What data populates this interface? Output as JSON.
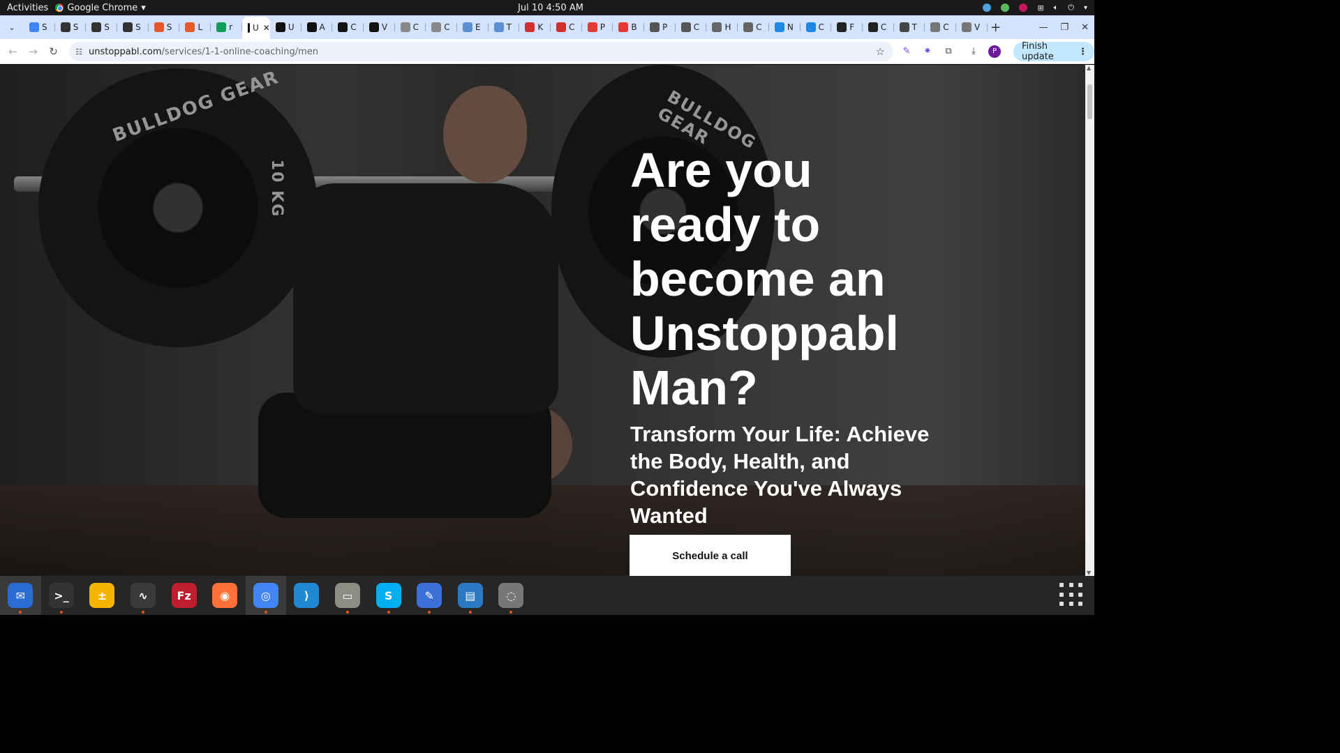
{
  "system_bar": {
    "activities": "Activities",
    "app_name": "Google Chrome",
    "clock": "Jul 10  4:50 AM"
  },
  "tabs": [
    {
      "letter": "S",
      "color": "#4285f4",
      "icon": "docs-icon"
    },
    {
      "letter": "S",
      "color": "#333333",
      "icon": "snp-icon"
    },
    {
      "letter": "S",
      "color": "#333333",
      "icon": "snp-icon"
    },
    {
      "letter": "S",
      "color": "#333333",
      "icon": "snp-icon"
    },
    {
      "letter": "S",
      "color": "#e8552b",
      "icon": "red-face-icon"
    },
    {
      "letter": "L",
      "color": "#e85a2b",
      "icon": "l-logo-icon"
    },
    {
      "letter": "r",
      "color": "#0f9d58",
      "icon": "sheets-plus-icon"
    },
    {
      "letter": "U",
      "color": "#111111",
      "icon": "unstoppabl-icon",
      "active": true
    },
    {
      "letter": "U",
      "color": "#111111",
      "icon": "unstoppabl-icon"
    },
    {
      "letter": "A",
      "color": "#111111",
      "icon": "unstoppabl-icon"
    },
    {
      "letter": "C",
      "color": "#111111",
      "icon": "unstoppabl-icon"
    },
    {
      "letter": "V",
      "color": "#111111",
      "icon": "unstoppabl-icon"
    },
    {
      "letter": "C",
      "color": "#888888",
      "icon": "sketch-icon"
    },
    {
      "letter": "C",
      "color": "#888888",
      "icon": "sketch-icon"
    },
    {
      "letter": "E",
      "color": "#5b8fd1",
      "icon": "pattern-icon"
    },
    {
      "letter": "T",
      "color": "#5b8fd1",
      "icon": "pattern-icon"
    },
    {
      "letter": "K",
      "color": "#d32f2f",
      "icon": "k-red-icon"
    },
    {
      "letter": "C",
      "color": "#d32f2f",
      "icon": "k-red-icon"
    },
    {
      "letter": "P",
      "color": "#e53935",
      "icon": "code-icon"
    },
    {
      "letter": "B",
      "color": "#e53935",
      "icon": "code-icon"
    },
    {
      "letter": "P",
      "color": "#555555",
      "icon": "bird-icon"
    },
    {
      "letter": "C",
      "color": "#555555",
      "icon": "bird-icon"
    },
    {
      "letter": "H",
      "color": "#666666",
      "icon": "face-icon"
    },
    {
      "letter": "C",
      "color": "#666666",
      "icon": "face-icon"
    },
    {
      "letter": "N",
      "color": "#1e88e5",
      "icon": "globe-blue-icon"
    },
    {
      "letter": "C",
      "color": "#1e88e5",
      "icon": "globe-blue-icon"
    },
    {
      "letter": "F",
      "color": "#222222",
      "icon": "dark-circle-icon"
    },
    {
      "letter": "C",
      "color": "#222222",
      "icon": "dark-circle-icon"
    },
    {
      "letter": "T",
      "color": "#444444",
      "icon": "circle-icon"
    },
    {
      "letter": "C",
      "color": "#777777",
      "icon": "doc-icon"
    },
    {
      "letter": "V",
      "color": "#777777",
      "icon": "doc-icon"
    }
  ],
  "omnibox": {
    "host": "unstoppabl.com",
    "path": "/services/1-1-online-coaching/men"
  },
  "toolbar": {
    "finish_update": "Finish update",
    "profile_initial": "P"
  },
  "hero": {
    "headline": "Are you ready to become an Unstoppabl Man?",
    "subheadline": "Transform Your Life: Achieve the Body, Health, and Confidence You've Always Wanted",
    "cta": "Schedule a call",
    "plate_text_left": "BULLDOG GEAR",
    "plate_text_right": "BULLDOG GEAR",
    "plate_weight": "10 KG"
  },
  "dock": [
    {
      "name": "thunderbird",
      "color": "#2a6bd4",
      "glyph": "✉",
      "active": true,
      "running": true
    },
    {
      "name": "terminal",
      "color": "#333333",
      "glyph": ">_",
      "running": true
    },
    {
      "name": "calculator",
      "color": "#f4b400",
      "glyph": "±",
      "running": false
    },
    {
      "name": "system-monitor",
      "color": "#3a3a3a",
      "glyph": "∿",
      "running": true
    },
    {
      "name": "filezilla",
      "color": "#bf1e2e",
      "glyph": "Fz",
      "running": false
    },
    {
      "name": "firefox",
      "color": "#ff7139",
      "glyph": "◉",
      "running": false
    },
    {
      "name": "chrome",
      "color": "#4285f4",
      "glyph": "◎",
      "active": true,
      "running": true
    },
    {
      "name": "vscode",
      "color": "#1f8ad2",
      "glyph": "⟩",
      "running": false
    },
    {
      "name": "files",
      "color": "#8d8d86",
      "glyph": "▭",
      "running": true
    },
    {
      "name": "skype",
      "color": "#00aff0",
      "glyph": "S",
      "running": true
    },
    {
      "name": "text-editor",
      "color": "#3d6fd8",
      "glyph": "✎",
      "running": true
    },
    {
      "name": "libreoffice-writer",
      "color": "#2b79c2",
      "glyph": "▤",
      "running": true
    },
    {
      "name": "disks",
      "color": "#777777",
      "glyph": "◌",
      "running": true
    }
  ]
}
